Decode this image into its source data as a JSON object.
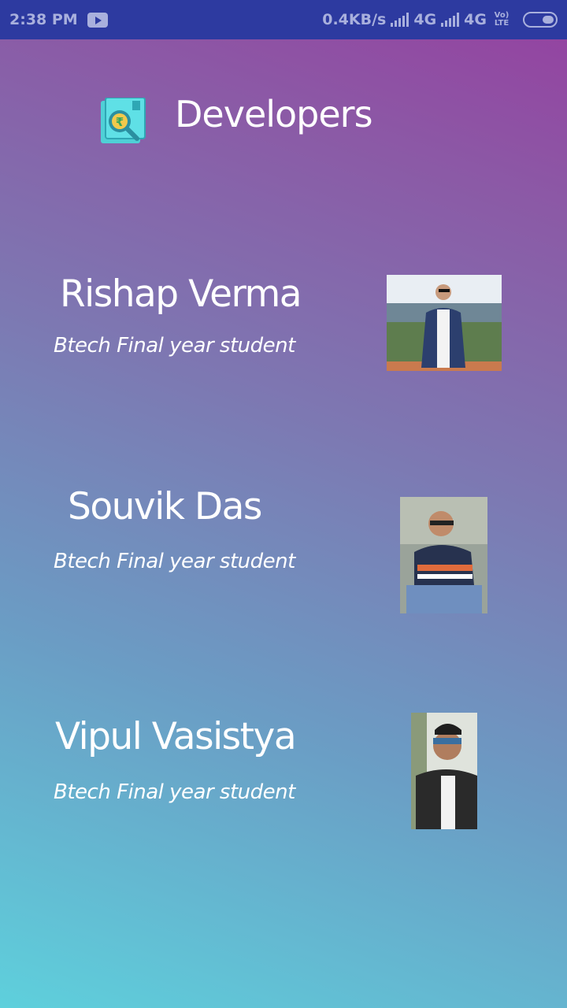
{
  "status_bar": {
    "time": "2:38 PM",
    "speed": "0.4KB/s",
    "network1": "4G",
    "network2": "4G",
    "volte": "Vo)\nLTE",
    "icons": [
      "youtube-icon",
      "signal-icon",
      "signal-icon",
      "volte-icon",
      "battery-icon"
    ]
  },
  "header": {
    "title": "Developers",
    "logo_icon": "rupee-search-icon"
  },
  "developers": [
    {
      "name": "Rishap Verma",
      "role": "Btech Final year student"
    },
    {
      "name": "Souvik Das",
      "role": "Btech Final year student"
    },
    {
      "name": "Vipul Vasistya",
      "role": "Btech Final year student"
    }
  ]
}
